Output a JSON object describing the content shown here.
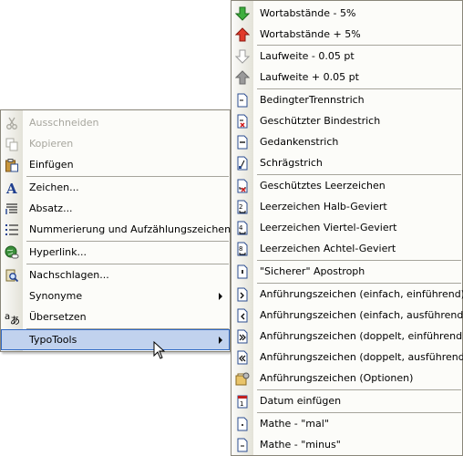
{
  "context_menu": {
    "items": [
      {
        "label": "Ausschneiden",
        "icon": "scissors-icon",
        "disabled": true
      },
      {
        "label": "Kopieren",
        "icon": "copy-icon",
        "disabled": true
      },
      {
        "label": "Einfügen",
        "icon": "paste-icon",
        "disabled": false
      },
      {
        "label": "Zeichen...",
        "icon": "font-icon",
        "disabled": false
      },
      {
        "label": "Absatz...",
        "icon": "paragraph-icon",
        "disabled": false
      },
      {
        "label": "Nummerierung und Aufzählungszeichen...",
        "icon": "bullet-list-icon",
        "disabled": false
      },
      {
        "label": "Hyperlink...",
        "icon": "hyperlink-icon",
        "disabled": false
      },
      {
        "label": "Nachschlagen...",
        "icon": "research-icon",
        "disabled": false
      },
      {
        "label": "Synonyme",
        "icon": "",
        "disabled": false
      },
      {
        "label": "Übersetzen",
        "icon": "translate-icon",
        "disabled": false
      },
      {
        "label": "TypoTools",
        "icon": "",
        "disabled": false
      }
    ]
  },
  "typotools_menu": {
    "items": [
      "Wortabstände - 5%",
      "Wortabstände + 5%",
      "Laufweite - 0.05 pt",
      "Laufweite + 0.05 pt",
      "BedingterTrennstrich",
      "Geschützter Bindestrich",
      "Gedankenstrich",
      "Schrägstrich",
      "Geschütztes Leerzeichen",
      "Leerzeichen Halb-Geviert",
      "Leerzeichen Viertel-Geviert",
      "Leerzeichen Achtel-Geviert",
      "\"Sicherer\" Apostroph",
      "Anführungszeichen (einfach, einführend)",
      "Anführungszeichen (einfach, ausführend)",
      "Anführungszeichen (doppelt, einführend)",
      "Anführungszeichen (doppelt, ausführend)",
      "Anführungszeichen (Optionen)",
      "Datum einfügen",
      "Mathe - \"mal\"",
      "Mathe - \"minus\""
    ]
  },
  "colors": {
    "highlight_bg": "#c1d2ee",
    "highlight_border": "#316ac5",
    "menu_bg": "#fcfcf9",
    "separator": "#a6a59c",
    "disabled_text": "#a7a69e"
  }
}
